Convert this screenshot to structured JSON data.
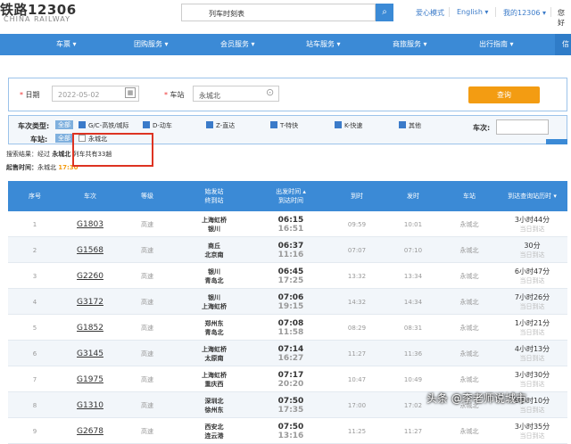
{
  "header": {
    "logo_title": "铁路12306",
    "logo_subtitle": "CHINA RAILWAY",
    "search_value": "列车时刻表",
    "links": [
      "爱心模式",
      "English ▾",
      "我的12306 ▾",
      "您好"
    ]
  },
  "nav": {
    "items": [
      "车票 ▾",
      "团购服务 ▾",
      "会员服务 ▾",
      "站车服务 ▾",
      "商旅服务 ▾",
      "出行指南 ▾"
    ],
    "last": "信"
  },
  "query": {
    "date_label": "日期",
    "date_value": "2022-05-02",
    "station_label": "车站",
    "station_value": "永城北",
    "button": "查询"
  },
  "filter": {
    "type_label": "车次类型:",
    "all_label": "全部",
    "types": [
      "G/C-高铁/城际",
      "D-动车",
      "Z-直达",
      "T-特快",
      "K-快速",
      "其他"
    ],
    "train_no_label": "车次:",
    "station_label": "车站:",
    "station_all": "全部",
    "station_option": "永城北"
  },
  "result": {
    "prefix": "搜索结果：经过",
    "station": "永城北",
    "suffix": "列车共有33趟",
    "start_label": "起售时间：",
    "start_station": "永城北",
    "start_time": "17:30"
  },
  "table": {
    "headers": [
      "序号",
      "车次",
      "等级",
      "始发站\n终到站",
      "出发时间 ▴\n到达时间",
      "到时",
      "发时",
      "车站",
      "到达查询站历时 ▾"
    ],
    "rows": [
      {
        "no": "1",
        "train": "G1803",
        "grade": "高速",
        "from": "上海虹桥",
        "to": "银川",
        "dep": "06:15",
        "arr": "16:51",
        "arrive": "09:59",
        "depart": "10:01",
        "station": "永城北",
        "dur": "3小时44分",
        "dur_sub": "当日到达"
      },
      {
        "no": "2",
        "train": "G1568",
        "grade": "高速",
        "from": "商丘",
        "to": "北京南",
        "dep": "06:37",
        "arr": "11:16",
        "arrive": "07:07",
        "depart": "07:10",
        "station": "永城北",
        "dur": "30分",
        "dur_sub": "当日到达"
      },
      {
        "no": "3",
        "train": "G2260",
        "grade": "高速",
        "from": "银川",
        "to": "青岛北",
        "dep": "06:45",
        "arr": "17:25",
        "arrive": "13:32",
        "depart": "13:34",
        "station": "永城北",
        "dur": "6小时47分",
        "dur_sub": "当日到达"
      },
      {
        "no": "4",
        "train": "G3172",
        "grade": "高速",
        "from": "银川",
        "to": "上海虹桥",
        "dep": "07:06",
        "arr": "19:15",
        "arrive": "14:32",
        "depart": "14:34",
        "station": "永城北",
        "dur": "7小时26分",
        "dur_sub": "当日到达"
      },
      {
        "no": "5",
        "train": "G1852",
        "grade": "高速",
        "from": "郑州东",
        "to": "青岛北",
        "dep": "07:08",
        "arr": "11:58",
        "arrive": "08:29",
        "depart": "08:31",
        "station": "永城北",
        "dur": "1小时21分",
        "dur_sub": "当日到达"
      },
      {
        "no": "6",
        "train": "G3145",
        "grade": "高速",
        "from": "上海虹桥",
        "to": "太原南",
        "dep": "07:14",
        "arr": "16:27",
        "arrive": "11:27",
        "depart": "11:36",
        "station": "永城北",
        "dur": "4小时13分",
        "dur_sub": "当日到达"
      },
      {
        "no": "7",
        "train": "G1975",
        "grade": "高速",
        "from": "上海虹桥",
        "to": "重庆西",
        "dep": "07:17",
        "arr": "20:20",
        "arrive": "10:47",
        "depart": "10:49",
        "station": "永城北",
        "dur": "3小时30分",
        "dur_sub": "当日到达"
      },
      {
        "no": "8",
        "train": "G1310",
        "grade": "高速",
        "from": "深圳北",
        "to": "徐州东",
        "dep": "07:50",
        "arr": "17:35",
        "arrive": "17:00",
        "depart": "17:02",
        "station": "永城北",
        "dur": "9小时10分",
        "dur_sub": "当日到达"
      },
      {
        "no": "9",
        "train": "G2678",
        "grade": "高速",
        "from": "西安北",
        "to": "连云港",
        "dep": "07:50",
        "arr": "13:16",
        "arrive": "11:25",
        "depart": "11:27",
        "station": "永城北",
        "dur": "3小时35分",
        "dur_sub": "当日到达"
      }
    ]
  },
  "watermark": "头条 @李老师说城市"
}
